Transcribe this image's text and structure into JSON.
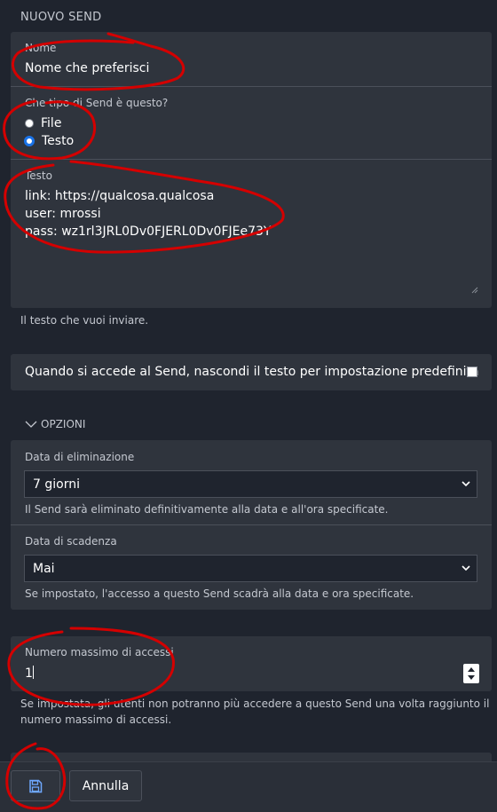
{
  "header": {
    "title": "NUOVO SEND"
  },
  "form": {
    "name": {
      "label": "Nome",
      "value": "Nome che preferisci"
    },
    "type": {
      "question": "Che tipo di Send è questo?",
      "options": [
        {
          "label": "File",
          "selected": false
        },
        {
          "label": "Testo",
          "selected": true
        }
      ]
    },
    "text": {
      "label": "Testo",
      "lines": [
        "link: https://qualcosa.qualcosa",
        "user: mrossi",
        "pass: wz1rl3JRL0Dv0FJERL0Dv0FJEe73Y"
      ],
      "help": "Il testo che vuoi inviare."
    },
    "hide_text": {
      "label": "Quando si accede al Send, nascondi il testo per impostazione predefinita",
      "checked": false
    }
  },
  "options": {
    "toggle_label": "OPZIONI",
    "deletion_date": {
      "label": "Data di eliminazione",
      "value": "7 giorni",
      "help": "Il Send sarà eliminato definitivamente alla data e all'ora specificate."
    },
    "expiration_date": {
      "label": "Data di scadenza",
      "value": "Mai",
      "help": "Se impostato, l'accesso a questo Send scadrà alla data e ora specificate."
    },
    "max_access": {
      "label": "Numero massimo di accessi",
      "value": "1",
      "help_line1": "Se impostata, gli utenti non potranno più accedere a questo Send una volta raggiunto il",
      "help_line2": "numero massimo di accessi."
    }
  },
  "footer": {
    "save_icon": "floppy-disk-icon",
    "cancel_label": "Annulla"
  },
  "colors": {
    "background": "#1f242e",
    "card": "#2f343d",
    "accent": "#1a73e8",
    "annotation": "#d40000"
  }
}
